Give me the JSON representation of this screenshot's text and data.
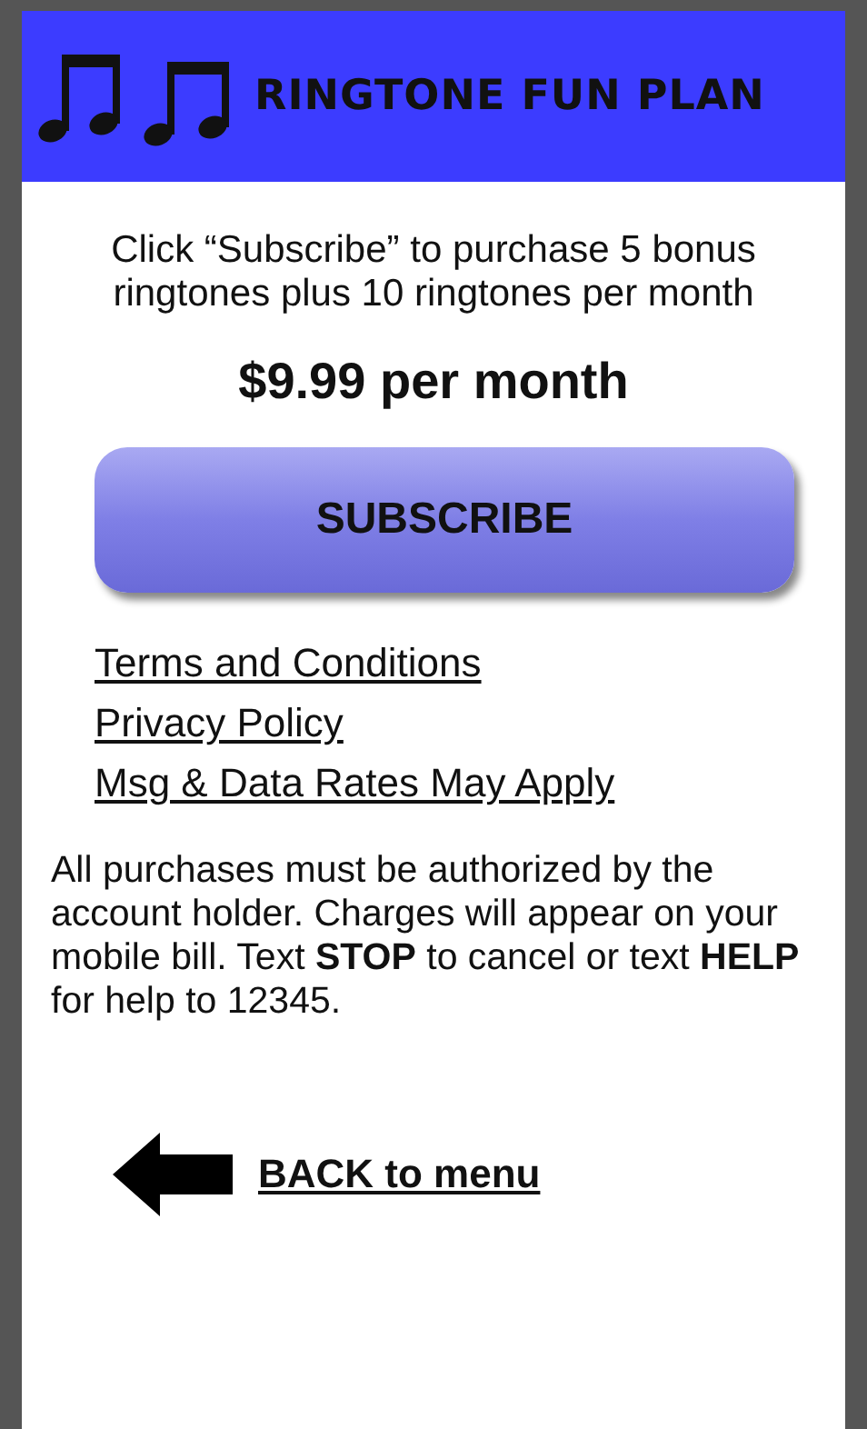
{
  "header": {
    "title": "RINGTONE FUN PLAN"
  },
  "intro": "Click “Subscribe” to purchase 5 bonus ringtones plus 10 ringtones per month",
  "price": "$9.99 per month",
  "subscribe_button": "SUBSCRIBE",
  "links": [
    "Terms and Conditions",
    "Privacy Policy",
    "Msg & Data Rates May Apply"
  ],
  "notice": "All purchases must be authorized by the account holder. Charges will appear on your mobile bill. Text **STOP** to cancel or text **HELP** for help to 12345.",
  "back_link": "BACK to menu"
}
